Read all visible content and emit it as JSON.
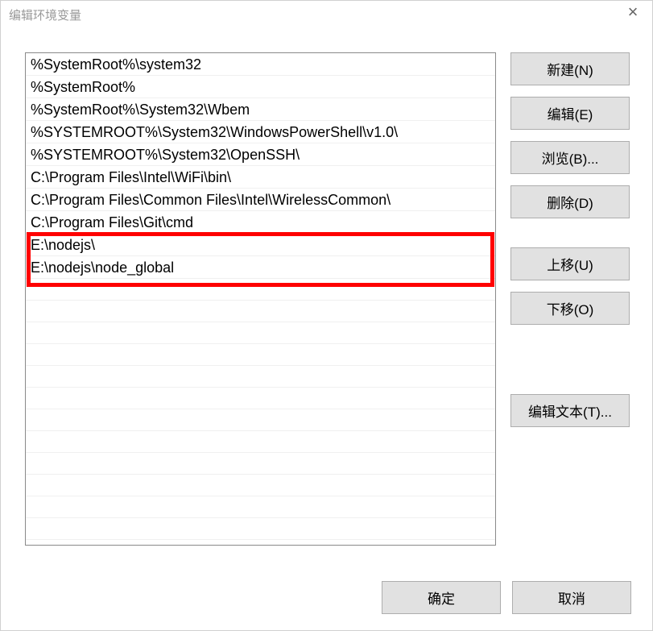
{
  "dialog": {
    "title": "编辑环境变量"
  },
  "path_entries": [
    "%SystemRoot%\\system32",
    "%SystemRoot%",
    "%SystemRoot%\\System32\\Wbem",
    "%SYSTEMROOT%\\System32\\WindowsPowerShell\\v1.0\\",
    "%SYSTEMROOT%\\System32\\OpenSSH\\",
    "C:\\Program Files\\Intel\\WiFi\\bin\\",
    "C:\\Program Files\\Common Files\\Intel\\WirelessCommon\\",
    "C:\\Program Files\\Git\\cmd",
    "E:\\nodejs\\",
    "E:\\nodejs\\node_global"
  ],
  "buttons": {
    "new": "新建(N)",
    "edit": "编辑(E)",
    "browse": "浏览(B)...",
    "delete": "删除(D)",
    "moveup": "上移(U)",
    "movedown": "下移(O)",
    "edittext": "编辑文本(T)...",
    "ok": "确定",
    "cancel": "取消"
  },
  "highlighted_indices": [
    8,
    9
  ]
}
